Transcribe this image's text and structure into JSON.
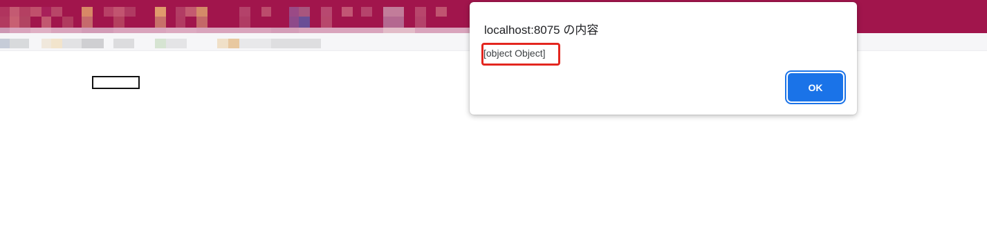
{
  "alert": {
    "title": "localhost:8075 の内容",
    "message": "[object Object]",
    "ok_label": "OK"
  },
  "colors": {
    "browser_bar": "#a1154c",
    "highlight_box": "#e3261f",
    "ok_button": "#1a73e8"
  }
}
